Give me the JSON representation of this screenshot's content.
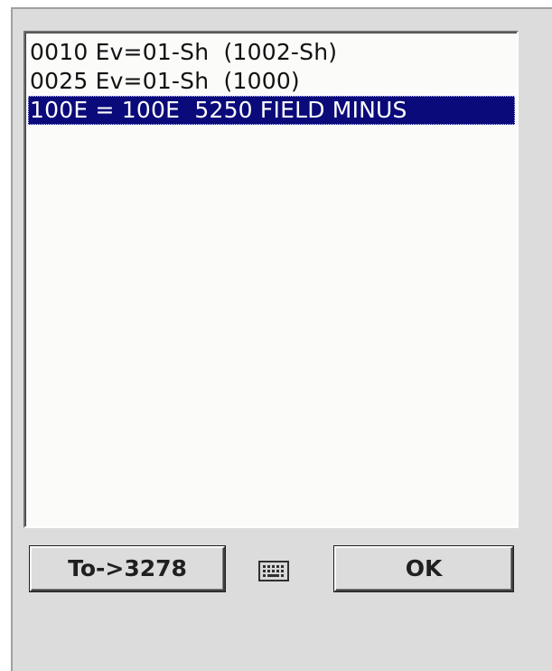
{
  "list": {
    "items": [
      {
        "text": "0010 Ev=01-Sh  (1002-Sh)",
        "selected": false
      },
      {
        "text": "0025 Ev=01-Sh  (1000)",
        "selected": false
      },
      {
        "text": "100E = 100E  5250 FIELD MINUS",
        "selected": true
      }
    ]
  },
  "buttons": {
    "to_label": "To->3278",
    "ok_label": "OK"
  },
  "icons": {
    "keyboard": "keyboard-icon"
  },
  "colors": {
    "selection_bg": "#0a0a7a",
    "selection_fg": "#ffffff",
    "window_bg": "#dcdcdc",
    "list_bg": "#fbfcfa"
  }
}
